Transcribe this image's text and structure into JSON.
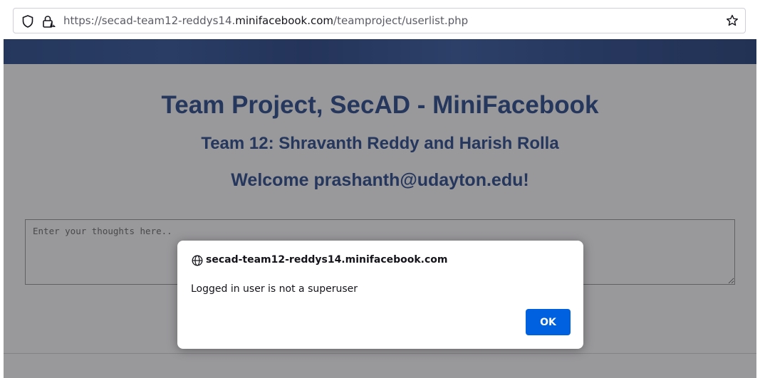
{
  "browser": {
    "url_prefix": "https://secad-team12-reddys14.",
    "url_host": "minifacebook.com",
    "url_path": "/teamproject/userlist.php"
  },
  "page": {
    "title": "Team Project, SecAD - MiniFacebook",
    "team": "Team 12: Shravanth Reddy and Harish Rolla",
    "welcome": "Welcome prashanth@udayton.edu!",
    "thoughts_placeholder": "Enter your thoughts here.."
  },
  "dialog": {
    "origin": "secad-team12-reddys14.minifacebook.com",
    "message": "Logged in user is not a superuser",
    "ok_label": "OK"
  },
  "colors": {
    "heading": "#2e4f8f",
    "ok_button": "#0061e0"
  }
}
